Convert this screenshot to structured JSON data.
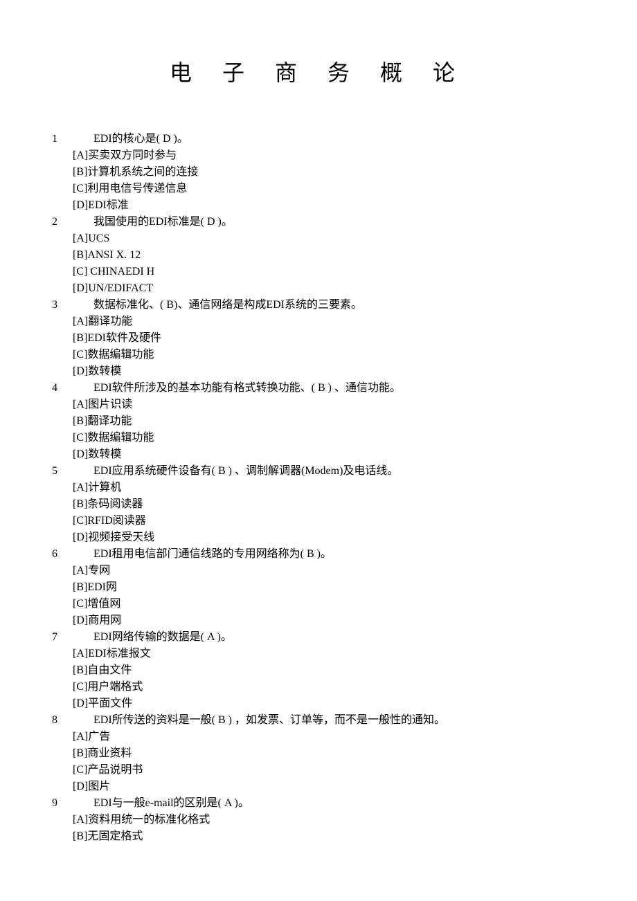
{
  "title": "电 子 商 务 概 论",
  "questions": [
    {
      "num": "1",
      "text": "EDI的核心是( D )。",
      "options": [
        "[A]买卖双方同时参与",
        "[B]计算机系统之间的连接",
        "[C]利用电信号传递信息",
        "[D]EDI标准"
      ]
    },
    {
      "num": "2",
      "text": "我国使用的EDI标准是( D )。",
      "options": [
        "[A]UCS",
        "[B]ANSI X. 12",
        "[C] CHINAEDI H",
        "[D]UN/EDIFACT"
      ]
    },
    {
      "num": "3",
      "text": "数据标准化、( B)、通信网络是构成EDI系统的三要素。",
      "options": [
        "[A]翻译功能",
        "[B]EDI软件及硬件",
        "[C]数据编辑功能",
        "[D]数转模"
      ]
    },
    {
      "num": "4",
      "text": "EDI软件所涉及的基本功能有格式转换功能、( B ) 、通信功能。",
      "options": [
        "[A]图片识读",
        "[B]翻译功能",
        "[C]数据编辑功能",
        "[D]数转模"
      ]
    },
    {
      "num": "5",
      "text": "EDI应用系统硬件设备有( B ) 、调制解调器(Modem)及电话线。",
      "options": [
        "[A]计算机",
        "[B]条码阅读器",
        "[C]RFID阅读器",
        "[D]视频接受天线"
      ]
    },
    {
      "num": "6",
      "text": "EDI租用电信部门通信线路的专用网络称为( B )。",
      "options": [
        "[A]专网",
        "[B]EDI网",
        "[C]增值网",
        "[D]商用网"
      ]
    },
    {
      "num": "7",
      "text": "EDI网络传输的数据是( A )。",
      "options": [
        "[A]EDI标准报文",
        "[B]自由文件",
        "[C]用户端格式",
        "[D]平面文件"
      ]
    },
    {
      "num": "8",
      "text": "EDI所传送的资料是一般( B ) ，如发票、订单等，而不是一般性的通知。",
      "options": [
        "[A]广告",
        "[B]商业资料",
        "[C]产品说明书",
        "[D]图片"
      ]
    },
    {
      "num": "9",
      "text": "EDI与一般e-mail的区别是( A )。",
      "options": [
        "[A]资料用统一的标准化格式",
        "[B]无固定格式"
      ]
    }
  ]
}
